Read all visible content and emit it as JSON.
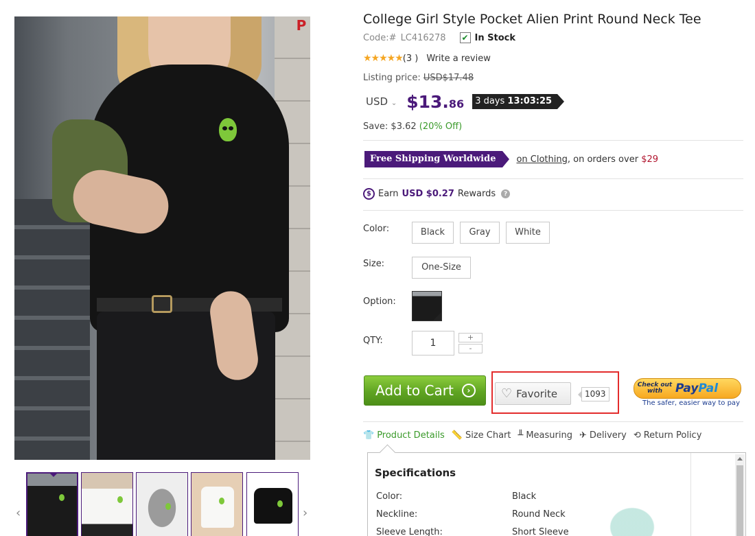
{
  "product": {
    "title": "College Girl Style Pocket Alien Print Round Neck Tee",
    "code_label": "Code:#",
    "code": "LC416278",
    "stock": "In Stock",
    "stock_check": "✔",
    "rating_stars": "★★★★★",
    "review_count": "(3 )",
    "write_review": "Write a review"
  },
  "pricing": {
    "listing_label": "Listing price:",
    "listing_price": "USD$17.48",
    "currency": "USD",
    "price_main": "$13.",
    "price_cents": "86",
    "countdown_days": "3 days",
    "countdown_time": "13:03:25",
    "save_label": "Save: $3.62",
    "save_percent": "(20% Off)"
  },
  "shipping": {
    "badge": "Free Shipping Worldwide",
    "on_clothing": "on Clothing",
    "text": ", on orders over",
    "threshold": "$29"
  },
  "rewards": {
    "coin": "$",
    "earn": "Earn",
    "amount": "USD $0.27",
    "label": "Rewards",
    "help": "?"
  },
  "options": {
    "color_label": "Color:",
    "colors": [
      "Black",
      "Gray",
      "White"
    ],
    "size_label": "Size:",
    "sizes": [
      "One-Size"
    ],
    "option_label": "Option:",
    "qty_label": "QTY:",
    "qty_value": "1",
    "qty_plus": "+",
    "qty_minus": "-"
  },
  "actions": {
    "add_to_cart": "Add to Cart",
    "add_arrow": "›",
    "favorite": "Favorite",
    "favorite_count": "1093",
    "paypal_small": "Check out with",
    "paypal_pay": "Pay",
    "paypal_pal": "Pal",
    "paypal_tagline": "The safer, easier way to pay"
  },
  "tabs": [
    {
      "label": "Product Details",
      "icon": "tshirt-icon",
      "glyph": "👕"
    },
    {
      "label": "Size Chart",
      "icon": "ruler-icon",
      "glyph": "📏"
    },
    {
      "label": "Measuring",
      "icon": "tape-icon",
      "glyph": "╨"
    },
    {
      "label": "Delivery",
      "icon": "plane-icon",
      "glyph": "✈"
    },
    {
      "label": "Return Policy",
      "icon": "return-icon",
      "glyph": "⟲"
    }
  ],
  "specs": {
    "title": "Specifications",
    "rows": [
      {
        "label": "Color:",
        "value": "Black"
      },
      {
        "label": "Neckline:",
        "value": "Round Neck"
      },
      {
        "label": "Sleeve Length:",
        "value": "Short Sleeve"
      }
    ]
  },
  "gallery": {
    "pin_icon": "P",
    "prev": "‹",
    "next": "›"
  },
  "colors": {
    "brand_purple": "#4b1a7a",
    "green": "#3a9a2a",
    "red_highlight": "#e32b2b"
  }
}
